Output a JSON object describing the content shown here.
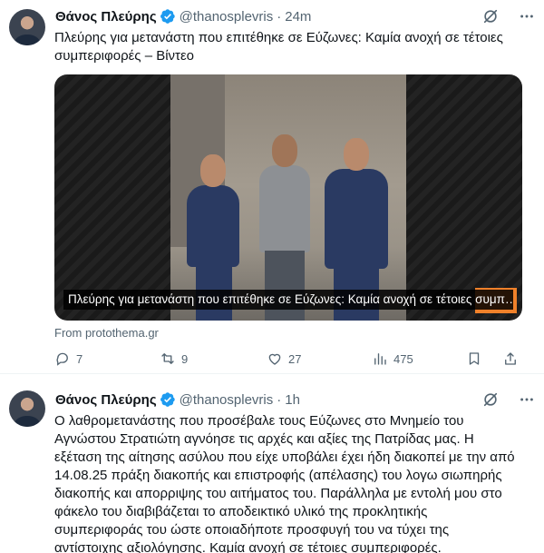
{
  "tweets": [
    {
      "author_name": "Θάνος Πλεύρης",
      "handle": "@thanosplevris",
      "separator": "·",
      "time": "24m",
      "text": "Πλεύρης για μετανάστη που επιτέθηκε σε Εύζωνες: Καμία ανοχή σε τέτοιες συμπεριφορές – Βίντεο",
      "video_caption": "Πλεύρης για μετανάστη που επιτέθηκε σε Εύζωνες: Καμία ανοχή σε τέτοιες συμπ…",
      "source": "From protothema.gr",
      "stats": {
        "replies": "7",
        "reposts": "9",
        "likes": "27",
        "views": "475"
      }
    },
    {
      "author_name": "Θάνος Πλεύρης",
      "handle": "@thanosplevris",
      "separator": "·",
      "time": "1h",
      "text_lines": [
        "Ο λαθρομετανάστης που προσέβαλε τους Εύζωνες στο Μνημείο του",
        "Αγνώστου Στρατιώτη αγνόησε τις αρχές και αξίες της Πατρίδας μας. Η",
        "εξέταση της αίτησης ασύλου που είχε υποβάλει έχει ήδη διακοπεί με την από",
        "14.08.25 πράξη διακοπής και επιστροφής (απέλασης) του λογω σιωπηρής",
        "διακοπής και απορριψης του αιτήματος του. Παράλληλα με εντολή μου στο",
        "φάκελο του διαβιβάζεται το αποδεικτικό υλικό της προκλητικής",
        "συμπεριφοράς του ώστε οποιαδήποτε προσφυγή του να τύχει της",
        "αντίστοιχης αξιολόγησης. Καμία ανοχή σε τέτοιες συμπεριφορές."
      ]
    }
  ],
  "icons": {
    "verified": "verified-badge-icon",
    "grok": "grok-icon",
    "more": "more-icon",
    "reply": "reply-icon",
    "repost": "repost-icon",
    "like": "like-icon",
    "views": "views-icon"
  },
  "colors": {
    "verified_badge": "#1d9bf0",
    "secondary_text": "#536471",
    "video_brand_badge": "#f0812a"
  }
}
